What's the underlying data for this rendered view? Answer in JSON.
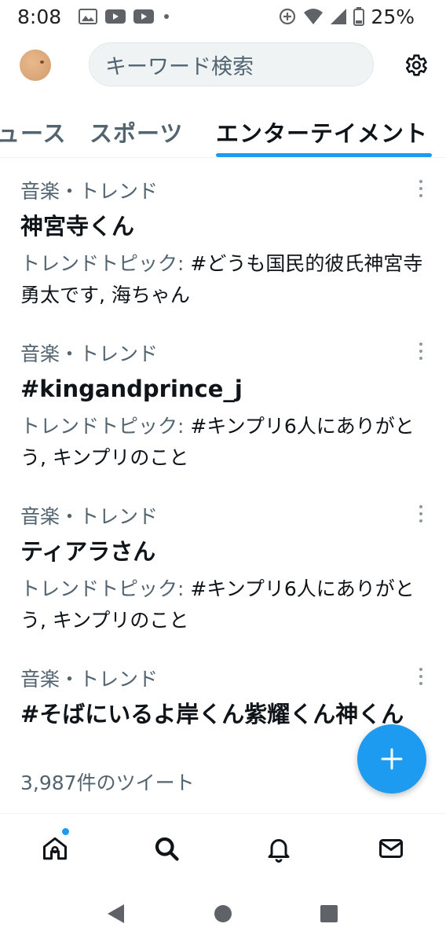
{
  "status_bar": {
    "time": "8:08",
    "left_icons": [
      "gallery-icon",
      "youtube-icon",
      "youtube-icon",
      "dot-icon"
    ],
    "right_icons": [
      "data-saver-icon",
      "wifi-icon",
      "signal-icon",
      "battery-icon"
    ],
    "battery": "25%"
  },
  "header": {
    "search_placeholder": "キーワード検索"
  },
  "tabs": [
    {
      "label": "ュース",
      "active": false
    },
    {
      "label": "スポーツ",
      "active": false
    },
    {
      "label": "エンターテイメント",
      "active": true
    }
  ],
  "trends": [
    {
      "category": "音楽・トレンド",
      "title": "神宮寺くん",
      "meta_label": "トレンドトピック: ",
      "meta_value": "#どうも国民的彼氏神宮寺勇太です, 海ちゃん"
    },
    {
      "category": "音楽・トレンド",
      "title": "#kingandprince_j",
      "meta_label": "トレンドトピック: ",
      "meta_value": "#キンプリ6人にありがとう, キンプリのこと"
    },
    {
      "category": "音楽・トレンド",
      "title": "ティアラさん",
      "meta_label": "トレンドトピック: ",
      "meta_value": "#キンプリ6人にありがとう, キンプリのこと"
    },
    {
      "category": "音楽・トレンド",
      "title": "#そばにいるよ岸くん紫耀くん神くん",
      "count": "3,987件のツイート"
    }
  ],
  "colors": {
    "accent": "#1d9bf0",
    "text_primary": "#0f1419",
    "text_secondary": "#536471"
  }
}
